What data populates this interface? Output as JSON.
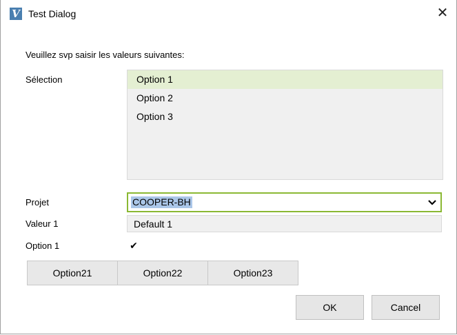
{
  "window": {
    "title": "Test Dialog",
    "app_icon_glyph": "V",
    "close_glyph": "✕"
  },
  "instructions": "Veuillez svp saisir les valeurs suivantes:",
  "selection": {
    "label": "Sélection",
    "items": [
      "Option 1",
      "Option 2",
      "Option 3"
    ],
    "selected_index": 0
  },
  "projet": {
    "label": "Projet",
    "value": "COOPER-BH"
  },
  "valeur1": {
    "label": "Valeur 1",
    "value": "Default 1"
  },
  "option1": {
    "label": "Option 1",
    "checked": true,
    "check_glyph": "✔"
  },
  "segment_buttons": [
    "Option21",
    "Option22",
    "Option23"
  ],
  "buttons": {
    "ok": "OK",
    "cancel": "Cancel"
  },
  "colors": {
    "selected_item_bg": "#e4efd2",
    "combo_border": "#8ab832",
    "text_highlight": "#aac6e8"
  }
}
